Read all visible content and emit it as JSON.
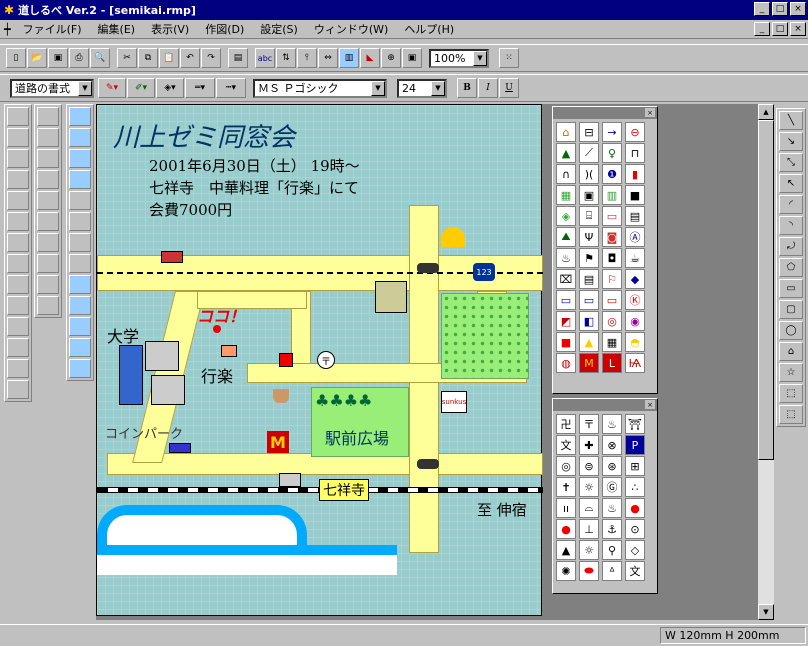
{
  "window": {
    "title": "道しるべ Ver.2 - [semikai.rmp]",
    "btn_min": "_",
    "btn_max": "□",
    "btn_close": "×"
  },
  "menu": [
    "ファイル(F)",
    "編集(E)",
    "表示(V)",
    "作図(D)",
    "設定(S)",
    "ウィンドウ(W)",
    "ヘルプ(H)"
  ],
  "toolbar1": {
    "zoom": "100%"
  },
  "toolbar2": {
    "road_style": "道路の書式",
    "font": "ＭＳ Ｐゴシック",
    "size": "24",
    "bold": "B",
    "italic": "I",
    "underline": "U"
  },
  "map": {
    "title": "川上ゼミ同窓会",
    "line1": "2001年6月30日（土） 19時〜",
    "line2": "七祥寺　中華料理「行楽」にて",
    "line3": "会費7000円",
    "here": "ココ！",
    "restaurant": "行楽",
    "university": "大学",
    "parking": "コインパーク",
    "plaza": "駅前広場",
    "station": "七祥寺",
    "to": "至 伸宿",
    "route": "123",
    "shop": "sunkus"
  },
  "status": {
    "size": "W 120mm H 200mm"
  },
  "colors": {
    "title_bar": "#000080",
    "road": "#ffff99",
    "paper": "#99cccc",
    "park": "#99ee77"
  }
}
